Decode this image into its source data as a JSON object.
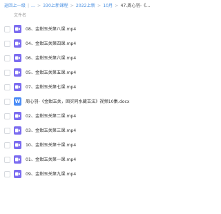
{
  "breadcrumb": {
    "back": "返回上一级",
    "item1": "...",
    "item2": "330上新课程",
    "item3": "2022上新",
    "item4": "10月",
    "current": "47.周心羽-《..."
  },
  "header": {
    "column_label": "文件名"
  },
  "files": [
    {
      "name": "08、金鉗玉关第八课.mp4",
      "type": "video"
    },
    {
      "name": "04、金鉗玉关第四课.mp4",
      "type": "video"
    },
    {
      "name": "06、金鉗玉关第六课.mp4",
      "type": "video"
    },
    {
      "name": "05、金鉗玉关第五课.mp4",
      "type": "video"
    },
    {
      "name": "07、金鉗玉关第七课.mp4",
      "type": "video"
    },
    {
      "name": "周心羽-《金鉗玉关，固实同水藏古法》视频10集.docx",
      "type": "doc"
    },
    {
      "name": "02、金鉗玉关第二课.mp4",
      "type": "video"
    },
    {
      "name": "03、金鉗玉关第三课.mp4",
      "type": "video"
    },
    {
      "name": "10、金鉗玉关第十课.mp4",
      "type": "video"
    },
    {
      "name": "01、金鉗玉关第一课.mp4",
      "type": "video"
    },
    {
      "name": "09、金鉗玉关第九课.mp4",
      "type": "video"
    }
  ],
  "colors": {
    "link": "#4a90e2",
    "video_icon": "#7b6cf0",
    "doc_icon": "#4c8df6"
  },
  "icons": {
    "video": "video-file-icon",
    "doc": "word-doc-icon",
    "doc_glyph": "W"
  }
}
